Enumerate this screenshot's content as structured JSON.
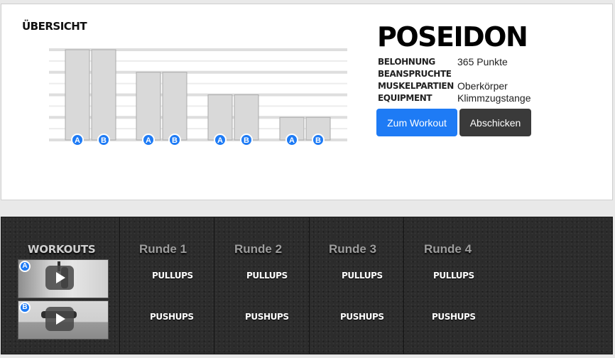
{
  "overview": {
    "title": "ÜBERSICHT",
    "chart_data": {
      "type": "bar",
      "categories": [
        "Runde 1",
        "Runde 2",
        "Runde 3",
        "Runde 4"
      ],
      "series": [
        {
          "name": "A",
          "values": [
            4,
            3,
            2,
            1
          ]
        },
        {
          "name": "B",
          "values": [
            4,
            3,
            2,
            1
          ]
        }
      ],
      "ylim": [
        0,
        4
      ],
      "grid": true,
      "bar_color": "#d9d9d9",
      "badge_color": "#1e7bf5"
    }
  },
  "workout": {
    "name": "POSEIDON",
    "info": [
      {
        "label": "BELOHNUNG",
        "value": "365 Punkte"
      },
      {
        "label": "BEANSPRUCHTE",
        "value": ""
      },
      {
        "label": "MUSKELPARTIEN",
        "value": "Oberkörper"
      },
      {
        "label": "EQUIPMENT",
        "value": "Klimmzugstange"
      }
    ],
    "buttons": {
      "start": "Zum Workout",
      "submit": "Abschicken"
    },
    "colors": {
      "primary": "#1e7bf5",
      "dark": "#3a3a3a"
    }
  },
  "schedule": {
    "workouts_title": "WORKOUTS",
    "videos": [
      {
        "badge": "A",
        "icon": "play-icon"
      },
      {
        "badge": "B",
        "icon": "play-icon"
      }
    ],
    "rounds": [
      {
        "title": "Runde 1",
        "a": "PULLUPS",
        "b": "PUSHUPS"
      },
      {
        "title": "Runde 2",
        "a": "PULLUPS",
        "b": "PUSHUPS"
      },
      {
        "title": "Runde 3",
        "a": "PULLUPS",
        "b": "PUSHUPS"
      },
      {
        "title": "Runde 4",
        "a": "PULLUPS",
        "b": "PUSHUPS"
      }
    ]
  }
}
